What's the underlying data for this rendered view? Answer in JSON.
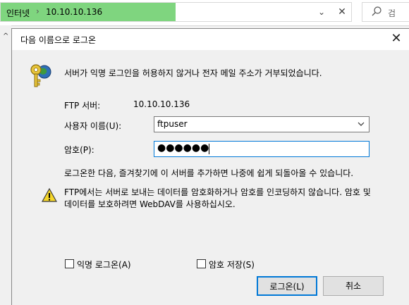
{
  "explorer": {
    "address_root": "인터넷",
    "address_ip": "10.10.10.136",
    "search_placeholder": "검"
  },
  "dialog": {
    "title": "다음 이름으로 로그온",
    "message": "서버가 익명 로그인을 허용하지 않거나 전자 메일 주소가 거부되었습니다.",
    "ftp_server_label": "FTP 서버:",
    "ftp_server_value": "10.10.10.136",
    "username_label": "사용자 이름(U):",
    "username_value": "ftpuser",
    "password_label": "암호(P):",
    "password_dots": "●●●●●●",
    "info": "로그온한 다음, 즐겨찾기에 이 서버를 추가하면 나중에 쉽게 되돌아올 수 있습니다.",
    "warning_line1": "FTP에서는 서버로 보내는 데이터를 암호화하거나 암호를 인코딩하지 않습니다. 암호 및",
    "warning_line2": "데이터를 보호하려면 WebDAV를 사용하십시오.",
    "anonymous_label": "익명 로그온(A)",
    "save_password_label": "암호 저장(S)",
    "login_button": "로그온(L)",
    "cancel_button": "취소"
  },
  "colors": {
    "address_progress": "#7fd57f",
    "focus_blue": "#0078d7"
  }
}
